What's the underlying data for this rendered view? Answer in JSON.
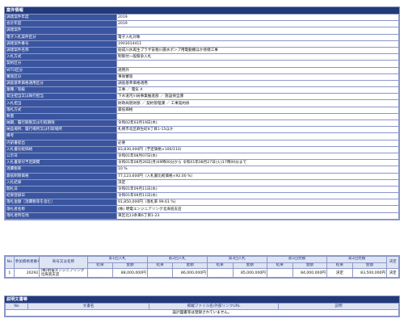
{
  "section_title": "案件情報",
  "info_rows": [
    {
      "label": "調達案件年度",
      "value": "2019"
    },
    {
      "label": "会計年度",
      "value": "2019"
    },
    {
      "label": "調達案件",
      "value": ""
    },
    {
      "label": "電子入札案件区分",
      "value": "電子入札対象"
    },
    {
      "label": "調達案件番号",
      "value": "1903014411"
    },
    {
      "label": "調達案件名称",
      "value": "創成川水再生プラザ安春川揚水ポンプ用電動機ほか修繕工事"
    },
    {
      "label": "入札方式",
      "value": "制限付一般競争入札"
    },
    {
      "label": "契約区分",
      "value": ""
    },
    {
      "label": "WTO区分",
      "value": "適用外"
    },
    {
      "label": "審査区分",
      "value": "事後審査"
    },
    {
      "label": "調査基準価格適用区分",
      "value": "調査基準価格適用"
    },
    {
      "label": "業種／等級",
      "value": "工事 ／ 電気 A"
    },
    {
      "label": "発注担当又は執行担当",
      "value": "下水道河川局事業推進部 ／ 施設保全課"
    },
    {
      "label": "入札担当",
      "value": "財政局管財部 ／ 契約管理課 ／ 工事契約係"
    },
    {
      "label": "落札方式",
      "value": "最低価格"
    },
    {
      "label": "数量",
      "value": ""
    },
    {
      "label": "納期、履行期限又は引取期限",
      "value": "令和02年03月19日(木)"
    },
    {
      "label": "納品場所、履行場所又は引取場所",
      "value": "札幌市北区麻生町8丁目1-15ほか"
    },
    {
      "label": "備考",
      "value": ""
    },
    {
      "label": "内訳書提出",
      "value": "必要"
    },
    {
      "label": "入札書比較価格",
      "value": "83,830,000円（予定価格×100/110）"
    },
    {
      "label": "公示日",
      "value": "令和01年08月07日(水)"
    },
    {
      "label": "入札書受付予定期間",
      "value": "令和01年08月26日(月)09時00分から 令和01年08月27日(火)17時00分まで"
    },
    {
      "label": "消費税率",
      "value": "10 %"
    },
    {
      "label": "最低制限価格",
      "value": "77,123,600円（入札書比較価格×92.00 %）"
    },
    {
      "label": "入札結果",
      "value": "決定"
    },
    {
      "label": "開札日",
      "value": "令和01年09月11日(水)"
    },
    {
      "label": "結果登録日",
      "value": "令和01年09月11日(水)"
    },
    {
      "label": "落札金額（消費税等を含む）",
      "value": "91,850,000円（落札率 99.61 %）"
    },
    {
      "label": "落札者名称",
      "value": "(株) 明電エンジニアリング北海道支店"
    },
    {
      "label": "落札者所在地",
      "value": "東区北13条東6丁目1-23"
    }
  ],
  "bids_table": {
    "headers": {
      "no": "No",
      "reg": "参加資格者番号",
      "name": "商号又は名称",
      "round1": "第1回入札",
      "round2": "第2回入札",
      "round3": "第3回入札",
      "neg1": "第1回見積",
      "neg2": "第2回見積",
      "decision": "決定",
      "result": "結果",
      "amount": "金額"
    },
    "rows": [
      {
        "no": "1",
        "reg": "20292",
        "name": "(株)明電エンジニアリング 北海道支店",
        "r1_result": "",
        "r1_amount": "88,000,000円",
        "r2_result": "",
        "r2_amount": "86,000,000円",
        "r3_result": "",
        "r3_amount": "85,000,000円",
        "n1_result": "",
        "n1_amount": "84,000,000円",
        "n2_result": "決定",
        "n2_amount": "83,500,000円",
        "decision": "決定"
      }
    ]
  },
  "docs_section_title": "説明文書等",
  "docs_table": {
    "headers": {
      "no": "No",
      "doc": "文書名",
      "link": "掲載ファイル名/外部リンクURL",
      "desc": "説明"
    },
    "empty_message": "設計図書等は登録されていません。"
  }
}
